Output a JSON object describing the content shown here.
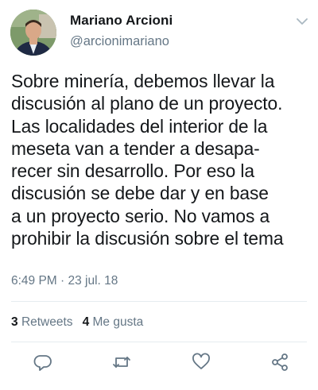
{
  "user": {
    "display_name": "Mariano Arcioni",
    "handle": "@arcionimariano",
    "avatar_icon": "profile-photo"
  },
  "tweet": {
    "lines": [
      "Sobre minería, debemos llevar la",
      "discusión al plano de un proyecto.",
      "Las localidades del interior de la",
      "meseta van a tender a desapa-",
      "recer sin desarrollo. Por eso la",
      "discusión se debe dar y en base",
      "a un proyecto serio. No vamos a",
      "prohibir la discusión sobre el tema"
    ],
    "timestamp": "6:49 PM · 23 jul. 18"
  },
  "stats": {
    "retweets_count": "3",
    "retweets_label": "Retweets",
    "likes_count": "4",
    "likes_label": "Me gusta"
  },
  "actions": {
    "reply_icon": "reply-icon",
    "retweet_icon": "retweet-icon",
    "like_icon": "heart-icon",
    "share_icon": "share-icon"
  },
  "colors": {
    "secondary_text": "#657786",
    "divider": "#e6ecf0"
  }
}
